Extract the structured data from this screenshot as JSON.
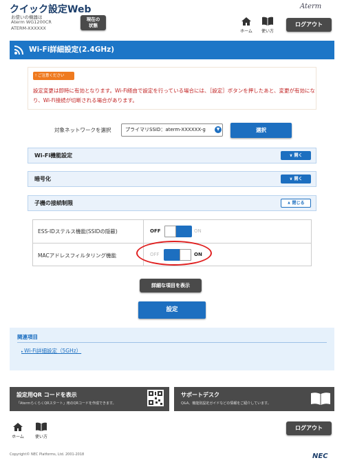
{
  "header": {
    "app_title": "クイック設定Web",
    "device_caption": "お使いの機器は",
    "model": "Aterm WG1200CR",
    "ssid_name": "ATERM-XXXXXX",
    "status_button_line1": "現在の",
    "status_button_line2": "状態",
    "home_label": "ホーム",
    "help_label": "使い方",
    "brand_logo": "Aterm",
    "logout_label": "ログアウト"
  },
  "page": {
    "title": "Wi-Fi詳細設定(2.4GHz)"
  },
  "notice": {
    "badge": "ご注意ください",
    "text": "設定変更は即時に有効となります。Wi-Fi経由で設定を行っている場合には、［設定］ボタンを押したあと、変更が有効になり、Wi-Fi接続が切断される場合があります。"
  },
  "network_select": {
    "label": "対象ネットワークを選択",
    "value": "プライマリSSID：aterm-XXXXXX-g",
    "button_label": "選択"
  },
  "sections": [
    {
      "label": "Wi-Fi機能設定",
      "toggle": "開く"
    },
    {
      "label": "暗号化",
      "toggle": "開く"
    },
    {
      "label": "子機の接続制限",
      "toggle": "閉じる"
    }
  ],
  "settings": [
    {
      "label": "ESS-IDステルス機能(SSIDの隠蔽)",
      "off_label": "OFF",
      "on_label": "ON",
      "state": "OFF"
    },
    {
      "label": "MACアドレスフィルタリング機能",
      "off_label": "OFF",
      "on_label": "ON",
      "state": "ON"
    }
  ],
  "buttons": {
    "show_detail": "詳細な項目を表示",
    "apply": "設定"
  },
  "related": {
    "title": "関連項目",
    "link": "Wi-Fi詳細設定（5GHz）"
  },
  "cards": [
    {
      "title": "設定用QR コードを表示",
      "desc": "「AtermらくらくQRスタート」用のQRコードを作成できます。"
    },
    {
      "title": "サポートデスク",
      "desc": "Q&A、機能別設定ガイドなどの情報をご紹介しています。"
    }
  ],
  "footer": {
    "home_label": "ホーム",
    "help_label": "使い方",
    "logout_label": "ログアウト",
    "copyright": "Copyright© NEC Platforms, Ltd. 2001-2018",
    "company_logo": "NEC"
  },
  "colors": {
    "accent": "#1d6fc0",
    "title_bar": "#1d76c7",
    "notice_red": "#c12222",
    "notice_badge": "#ef7a1f",
    "highlight": "#e02020"
  }
}
